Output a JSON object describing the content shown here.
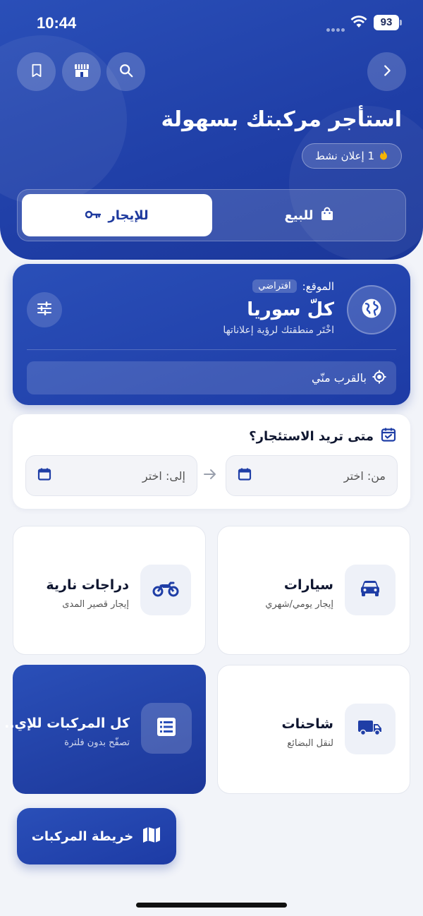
{
  "status_bar": {
    "time": "10:44",
    "battery": "93"
  },
  "header": {
    "title": "استأجر مركبتك بسهولة",
    "active_listings": "1 إعلان نشط",
    "toggle": {
      "rent_label": "للإيجار",
      "sale_label": "للبيع",
      "selected": "rent"
    }
  },
  "location": {
    "label": "الموقع:",
    "default_badge": "افتراضي",
    "value": "كلّ سوريا",
    "hint": "اخْتَر منطقتك لرؤية إعلاناتها",
    "near_me": "بالقرب منّي"
  },
  "dates": {
    "title": "متى تريد الاستئجار؟",
    "from_label": "من: اختر",
    "to_label": "إلى: اختر"
  },
  "categories": [
    {
      "title": "سيارات",
      "subtitle": "إيجار يومي/شهري",
      "icon": "car-icon"
    },
    {
      "title": "دراجات نارية",
      "subtitle": "إيجار قصير المدى",
      "icon": "motorcycle-icon"
    },
    {
      "title": "شاحنات",
      "subtitle": "لنقل البضائع",
      "icon": "truck-icon"
    },
    {
      "title": "كل المركبات للإي..",
      "subtitle": "تصفّح بدون فلترة",
      "icon": "list-icon"
    }
  ],
  "map_button": {
    "label": "خريطة المركبات"
  },
  "colors": {
    "primary": "#1f3ea6",
    "accent_flame": "#f5b400",
    "card_bg": "#ffffff",
    "page_bg": "#f2f4f9"
  }
}
